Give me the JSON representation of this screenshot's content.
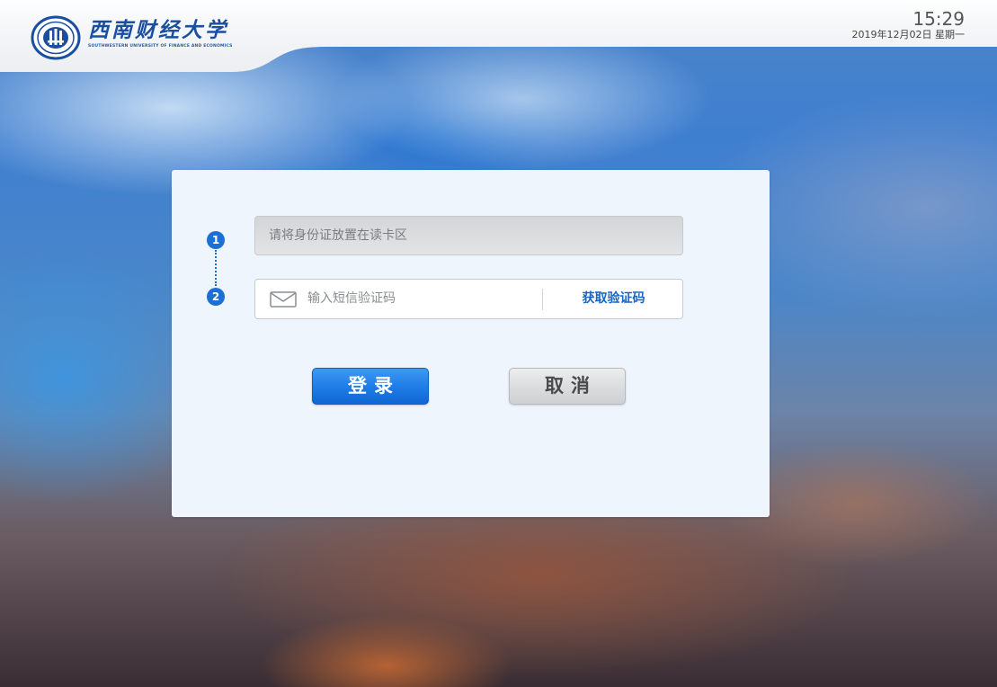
{
  "header": {
    "logo_cn": "西南财经大学",
    "logo_en": "SOUTHWESTERN UNIVERSITY OF FINANCE AND ECONOMICS",
    "logo_icon": "university-seal-icon",
    "time": "15:29",
    "date": "2019年12月02日 星期一"
  },
  "login": {
    "steps": [
      "1",
      "2"
    ],
    "id_card_prompt": "请将身份证放置在读卡区",
    "sms_icon": "envelope-icon",
    "sms_placeholder": "输入短信验证码",
    "sms_value": "",
    "get_code_label": "获取验证码",
    "login_label": "登录",
    "cancel_label": "取消"
  },
  "colors": {
    "accent": "#1b6fd6",
    "login_button": "#1f7ee8",
    "link": "#1a64c2",
    "brand": "#1a4fa0"
  }
}
